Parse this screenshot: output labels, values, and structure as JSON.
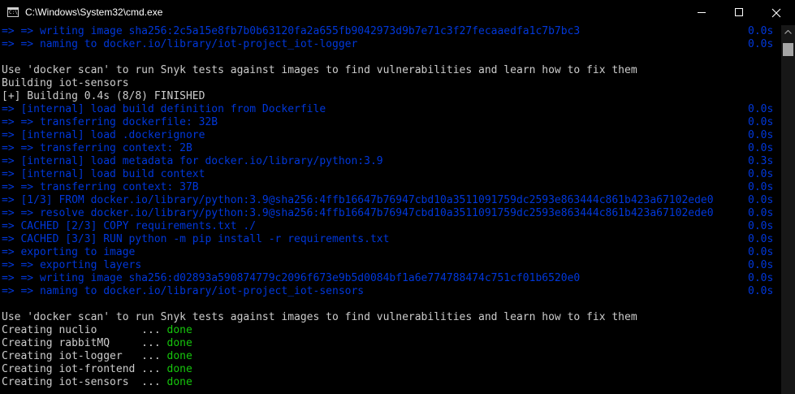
{
  "window": {
    "title": "C:\\Windows\\System32\\cmd.exe",
    "icon": "cmd-icon",
    "icon_text": "C:\\"
  },
  "colors": {
    "background": "#000000",
    "text": "#cccccc",
    "build_step": "#0037da",
    "done": "#16c60c"
  },
  "console": {
    "lines": [
      {
        "text": "=> => writing image sha256:2c5a15e8fb7b0b63120fa2a655fb9042973d9b7e71c3f27fecaaedfa1c7b7bc3",
        "time": "0.0s",
        "color": "blue"
      },
      {
        "text": "=> => naming to docker.io/library/iot-project_iot-logger",
        "time": "0.0s",
        "color": "blue"
      },
      {
        "text": "",
        "time": "",
        "color": "white"
      },
      {
        "text": "Use 'docker scan' to run Snyk tests against images to find vulnerabilities and learn how to fix them",
        "time": "",
        "color": "white"
      },
      {
        "text": "Building iot-sensors",
        "time": "",
        "color": "white"
      },
      {
        "text": "[+] Building 0.4s (8/8) FINISHED",
        "time": "",
        "color": "white"
      },
      {
        "text": "=> [internal] load build definition from Dockerfile",
        "time": "0.0s",
        "color": "blue"
      },
      {
        "text": "=> => transferring dockerfile: 32B",
        "time": "0.0s",
        "color": "blue"
      },
      {
        "text": "=> [internal] load .dockerignore",
        "time": "0.0s",
        "color": "blue"
      },
      {
        "text": "=> => transferring context: 2B",
        "time": "0.0s",
        "color": "blue"
      },
      {
        "text": "=> [internal] load metadata for docker.io/library/python:3.9",
        "time": "0.3s",
        "color": "blue"
      },
      {
        "text": "=> [internal] load build context",
        "time": "0.0s",
        "color": "blue"
      },
      {
        "text": "=> => transferring context: 37B",
        "time": "0.0s",
        "color": "blue"
      },
      {
        "text": "=> [1/3] FROM docker.io/library/python:3.9@sha256:4ffb16647b76947cbd10a3511091759dc2593e863444c861b423a67102ede0",
        "time": "0.0s",
        "color": "blue"
      },
      {
        "text": "=> => resolve docker.io/library/python:3.9@sha256:4ffb16647b76947cbd10a3511091759dc2593e863444c861b423a67102ede0",
        "time": "0.0s",
        "color": "blue"
      },
      {
        "text": "=> CACHED [2/3] COPY requirements.txt ./",
        "time": "0.0s",
        "color": "blue"
      },
      {
        "text": "=> CACHED [3/3] RUN python -m pip install -r requirements.txt",
        "time": "0.0s",
        "color": "blue"
      },
      {
        "text": "=> exporting to image",
        "time": "0.0s",
        "color": "blue"
      },
      {
        "text": "=> => exporting layers",
        "time": "0.0s",
        "color": "blue"
      },
      {
        "text": "=> => writing image sha256:d02893a590874779c2096f673e9b5d0084bf1a6e774788474c751cf01b6520e0",
        "time": "0.0s",
        "color": "blue"
      },
      {
        "text": "=> => naming to docker.io/library/iot-project_iot-sensors",
        "time": "0.0s",
        "color": "blue"
      },
      {
        "text": "",
        "time": "",
        "color": "white"
      },
      {
        "text": "Use 'docker scan' to run Snyk tests against images to find vulnerabilities and learn how to fix them",
        "time": "",
        "color": "white"
      },
      {
        "text": "Creating nuclio       ... ",
        "done": "done",
        "time": "",
        "color": "white"
      },
      {
        "text": "Creating rabbitMQ     ... ",
        "done": "done",
        "time": "",
        "color": "white"
      },
      {
        "text": "Creating iot-logger   ... ",
        "done": "done",
        "time": "",
        "color": "white"
      },
      {
        "text": "Creating iot-frontend ... ",
        "done": "done",
        "time": "",
        "color": "white"
      },
      {
        "text": "Creating iot-sensors  ... ",
        "done": "done",
        "time": "",
        "color": "white"
      }
    ]
  }
}
